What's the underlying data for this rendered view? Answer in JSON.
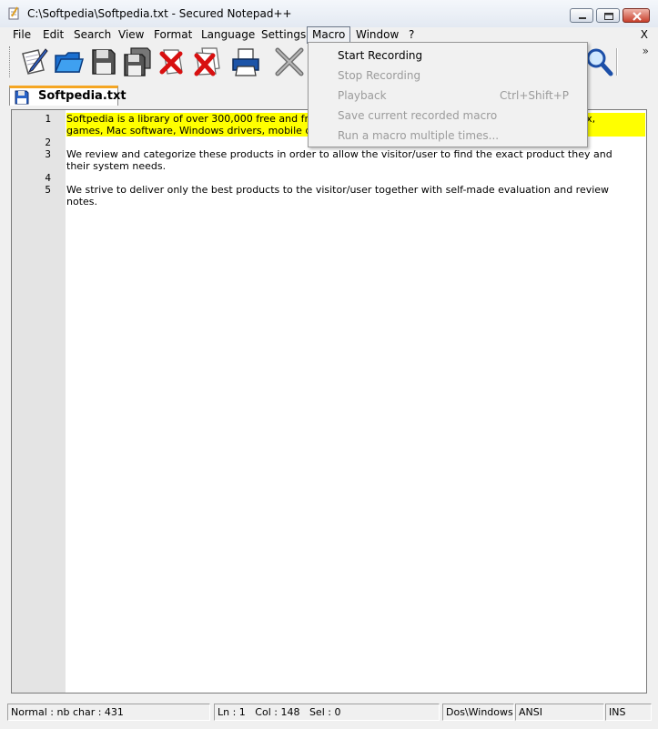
{
  "window": {
    "title": "C:\\Softpedia\\Softpedia.txt - Secured Notepad++"
  },
  "menu": {
    "items": [
      "File",
      "Edit",
      "Search",
      "View",
      "Format",
      "Language",
      "Settings",
      "Macro",
      "Window",
      "?"
    ],
    "active": "Macro",
    "close_doc": "X"
  },
  "toolbar": {
    "icons": [
      "new-file-icon",
      "open-file-icon",
      "save-icon",
      "save-all-icon",
      "close-icon",
      "close-all-icon",
      "print-icon",
      "cut-icon",
      "find-icon"
    ],
    "overflow": "»"
  },
  "tab": {
    "label": "Softpedia.txt"
  },
  "editor": {
    "lines": [
      {
        "num": "1",
        "text": "Softpedia is a library of over 300,000 free and free-to-try software programs for Windows and Unix/Linux,",
        "highlight": true
      },
      {
        "num": "",
        "text": "games, Mac software, Windows drivers, mobile devices and IT-related articles.",
        "highlight": true
      },
      {
        "num": "2",
        "text": "",
        "highlight": false
      },
      {
        "num": "3",
        "text": "We review and categorize these products in order to allow the visitor/user to find the exact product they and",
        "highlight": false
      },
      {
        "num": "",
        "text": "their system needs.",
        "highlight": false
      },
      {
        "num": "4",
        "text": "",
        "highlight": false
      },
      {
        "num": "5",
        "text": "We strive to deliver only the best products to the visitor/user together with self-made evaluation and review",
        "highlight": false
      },
      {
        "num": "",
        "text": "notes.",
        "highlight": false
      }
    ]
  },
  "macro_menu": {
    "items": [
      {
        "label": "Start Recording",
        "shortcut": "",
        "enabled": true
      },
      {
        "label": "Stop Recording",
        "shortcut": "",
        "enabled": false
      },
      {
        "label": "Playback",
        "shortcut": "Ctrl+Shift+P",
        "enabled": false
      },
      {
        "label": "Save current recorded macro",
        "shortcut": "",
        "enabled": false
      },
      {
        "label": "Run a macro multiple times...",
        "shortcut": "",
        "enabled": false
      }
    ]
  },
  "status": {
    "mode": "Normal : nb char : 431",
    "position": "Ln : 1   Col : 148   Sel : 0",
    "eol": "Dos\\Windows",
    "encoding": "ANSI",
    "ins": "INS"
  },
  "colors": {
    "highlight": "#ffff00",
    "tab_accent": "#f5a623"
  }
}
